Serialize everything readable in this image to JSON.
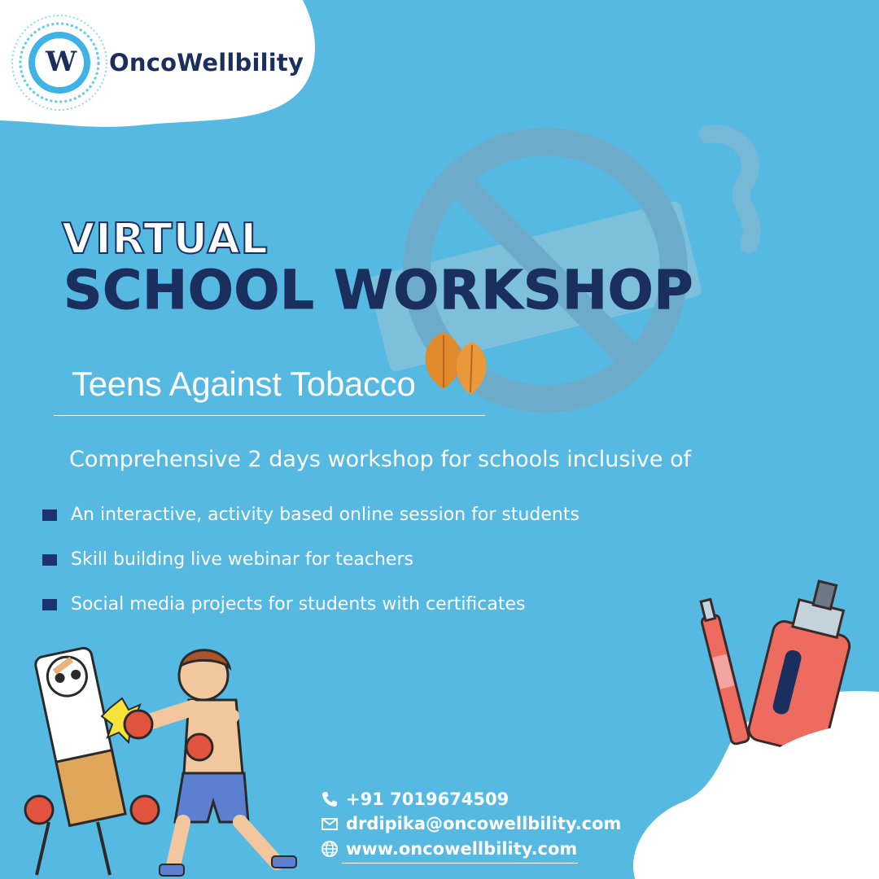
{
  "brand": {
    "name": "OncoWellbility",
    "logo_letter": "W"
  },
  "heading": {
    "line1": "VIRTUAL",
    "line2": "SCHOOL WORKSHOP"
  },
  "subtitle": "Teens Against Tobacco",
  "intro": "Comprehensive 2 days workshop for schools inclusive of",
  "bullets": [
    "An interactive, activity based online session for students",
    "Skill building live webinar for teachers",
    "Social media projects for students with certificates"
  ],
  "contact": {
    "phone": "+91  7019674509",
    "email": "drdipika@oncowellbility.com",
    "website": "www.oncowellbility.com"
  },
  "icons": {
    "phone": "phone-icon",
    "email": "envelope-icon",
    "website": "globe-icon",
    "background": "no-smoking-icon",
    "leaf": "tobacco-leaf-icon"
  },
  "colors": {
    "background": "#55b9e2",
    "navy": "#1b2f5e",
    "white": "#ffffff",
    "accent_red": "#ee6b60"
  }
}
